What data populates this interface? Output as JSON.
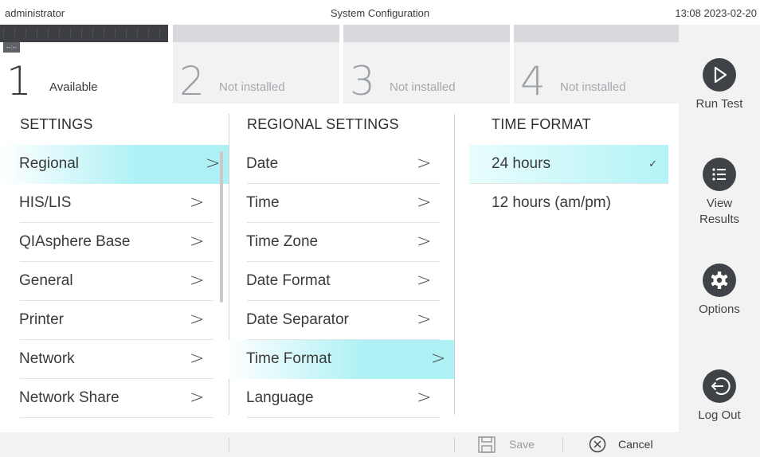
{
  "topbar": {
    "user": "administrator",
    "title": "System Configuration",
    "datetime": "13:08 2023-02-20"
  },
  "modules": [
    {
      "number": "1",
      "status": "Available",
      "tag": "--:--",
      "active": true
    },
    {
      "number": "2",
      "status": "Not installed",
      "active": false
    },
    {
      "number": "3",
      "status": "Not installed",
      "active": false
    },
    {
      "number": "4",
      "status": "Not installed",
      "active": false
    }
  ],
  "sidebar": {
    "run_test": "Run Test",
    "view_results": "View Results",
    "options": "Options",
    "log_out": "Log Out"
  },
  "settings": {
    "header": "SETTINGS",
    "items": [
      {
        "label": "Regional",
        "selected": true
      },
      {
        "label": "HIS/LIS"
      },
      {
        "label": "QIAsphere Base"
      },
      {
        "label": "General"
      },
      {
        "label": "Printer"
      },
      {
        "label": "Network"
      },
      {
        "label": "Network Share"
      }
    ]
  },
  "regional": {
    "header": "REGIONAL SETTINGS",
    "items": [
      {
        "label": "Date"
      },
      {
        "label": "Time"
      },
      {
        "label": "Time Zone"
      },
      {
        "label": "Date Format"
      },
      {
        "label": "Date Separator"
      },
      {
        "label": "Time Format",
        "selected": true
      },
      {
        "label": "Language"
      }
    ]
  },
  "time_format": {
    "header": "TIME FORMAT",
    "options": [
      {
        "label": "24 hours",
        "selected": true,
        "check": "✓"
      },
      {
        "label": "12 hours (am/pm)"
      }
    ]
  },
  "bottombar": {
    "save": "Save",
    "cancel": "Cancel"
  },
  "chevron": ">",
  "colors": {
    "selection": "#aef1f5",
    "sidebar_button": "#3f4348",
    "panel_gray": "#f2f2f2"
  }
}
